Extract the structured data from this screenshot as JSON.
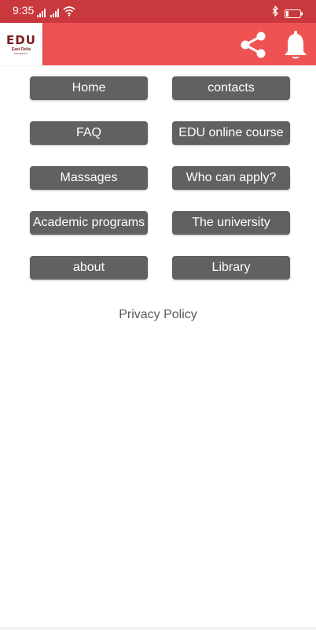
{
  "status_bar": {
    "time": "9:35",
    "icons": [
      "signal-icon",
      "wifi-icon",
      "bluetooth-icon",
      "battery-icon"
    ],
    "color": "#c8383c"
  },
  "app_bar": {
    "logo_text": "EDU",
    "logo_subtitle": "East Delta",
    "logo_subtitle_small": "UNIVERSITY",
    "icons": [
      "share-icon",
      "bell-icon"
    ],
    "color": "#ee5253"
  },
  "menu": {
    "home": "Home",
    "contacts": "contacts",
    "faq": "FAQ",
    "online_course": "EDU online course",
    "massages": "Massages",
    "who_can_apply": "Who can apply?",
    "academic_programs": "Academic programs",
    "the_university": "The university",
    "about": "about",
    "library": "Library",
    "button_color": "#616161"
  },
  "footer": {
    "privacy_policy": "Privacy Policy"
  }
}
